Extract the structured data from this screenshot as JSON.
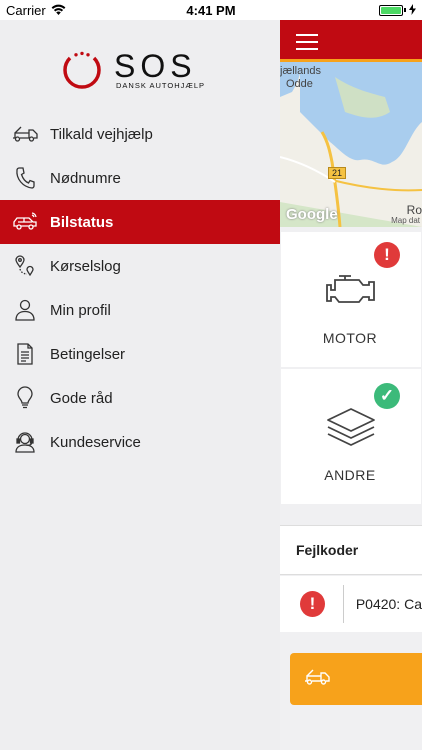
{
  "status_bar": {
    "carrier": "Carrier",
    "time": "4:41 PM"
  },
  "logo": {
    "brand": "SOS",
    "tagline": "DANSK AUTOHJÆLP"
  },
  "menu": {
    "items": [
      {
        "label": "Tilkald vejhjælp",
        "icon": "tow-truck-icon"
      },
      {
        "label": "Nødnumre",
        "icon": "phone-icon"
      },
      {
        "label": "Bilstatus",
        "icon": "car-status-icon",
        "active": true
      },
      {
        "label": "Kørselslog",
        "icon": "route-pin-icon"
      },
      {
        "label": "Min profil",
        "icon": "person-icon"
      },
      {
        "label": "Betingelser",
        "icon": "document-icon"
      },
      {
        "label": "Gode råd",
        "icon": "lightbulb-icon"
      },
      {
        "label": "Kundeservice",
        "icon": "headset-icon"
      }
    ]
  },
  "map": {
    "place_line1": "jællands",
    "place_line2": "Odde",
    "road_number": "21",
    "place_right": "Ro",
    "provider": "Google",
    "attribution": "Map dat"
  },
  "status_cards": [
    {
      "label": "MOTOR",
      "state": "error",
      "icon": "engine-icon"
    },
    {
      "label": "ANDRE",
      "state": "ok",
      "icon": "layers-icon"
    }
  ],
  "fault_codes": {
    "title": "Fejlkoder",
    "items": [
      {
        "code": "P0420: Ca"
      }
    ]
  },
  "colors": {
    "brand_red": "#c00a12",
    "accent_orange": "#f7a21b",
    "error_red": "#e03a3a",
    "ok_green": "#3cba7a",
    "drawer_bg": "#eeeef0"
  }
}
